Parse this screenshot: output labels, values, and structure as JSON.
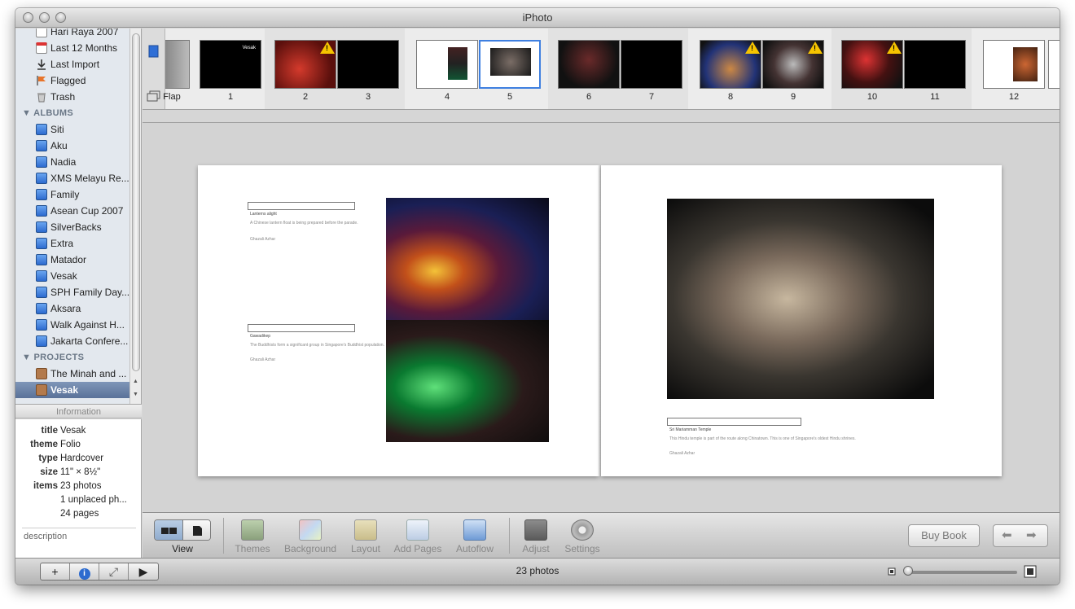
{
  "window": {
    "title": "iPhoto"
  },
  "sidebar": {
    "library_items": [
      {
        "label": "Hari Raya 2007",
        "icon": "event-icon"
      },
      {
        "label": "Last 12 Months",
        "icon": "calendar-icon"
      },
      {
        "label": "Last Import",
        "icon": "import-icon"
      },
      {
        "label": "Flagged",
        "icon": "flag-icon"
      },
      {
        "label": "Trash",
        "icon": "trash-icon"
      }
    ],
    "albums_header": "ALBUMS",
    "albums": [
      "Siti",
      "Aku",
      "Nadia",
      "XMS Melayu Re...",
      "Family",
      "Asean Cup 2007",
      "SilverBacks",
      "Extra",
      "Matador",
      "Vesak",
      "SPH Family Day...",
      "Aksara",
      "Walk Against H...",
      "Jakarta Confere..."
    ],
    "projects_header": "PROJECTS",
    "projects": [
      {
        "label": "The Minah and ...",
        "selected": false
      },
      {
        "label": "Vesak",
        "selected": true
      }
    ]
  },
  "info": {
    "header": "Information",
    "rows": [
      {
        "key": "title",
        "value": "Vesak"
      },
      {
        "key": "theme",
        "value": "Folio"
      },
      {
        "key": "type",
        "value": "Hardcover"
      },
      {
        "key": "size",
        "value": "11\" × 8½\""
      },
      {
        "key": "items",
        "value": "23 photos"
      },
      {
        "key": "",
        "value": "1 unplaced ph..."
      },
      {
        "key": "",
        "value": "24 pages"
      }
    ],
    "description_placeholder": "description"
  },
  "strip": {
    "pages": [
      {
        "label": "Flap",
        "style": "gray",
        "warning": false,
        "selected": false
      },
      {
        "label": "1",
        "style": "black",
        "warning": false,
        "selected": false,
        "text": "Vesak"
      },
      {
        "label": "2",
        "style": "photo-red",
        "warning": true,
        "selected": false
      },
      {
        "label": "3",
        "style": "black",
        "warning": false,
        "selected": false
      },
      {
        "label": "4",
        "style": "white",
        "warning": false,
        "selected": false
      },
      {
        "label": "5",
        "style": "white",
        "warning": false,
        "selected": true
      },
      {
        "label": "6",
        "style": "photo-night",
        "warning": false,
        "selected": false
      },
      {
        "label": "7",
        "style": "black",
        "warning": false,
        "selected": false
      },
      {
        "label": "8",
        "style": "photo-lights",
        "warning": true,
        "selected": false
      },
      {
        "label": "9",
        "style": "photo-night",
        "warning": true,
        "selected": false
      },
      {
        "label": "10",
        "style": "photo-lights",
        "warning": true,
        "selected": false
      },
      {
        "label": "11",
        "style": "black",
        "warning": false,
        "selected": false
      },
      {
        "label": "12",
        "style": "white",
        "warning": false,
        "selected": false
      }
    ]
  },
  "spread": {
    "left_captions": [
      {
        "title": "Lanterns alight",
        "body": "A Chinese lantern float is being prepared before the parade.",
        "credit": "Ghazali Azhar"
      },
      {
        "title": "Gawadikep",
        "body": "The Buddhists form a significant group in Singapore's Buddhist population.",
        "credit": "Ghazali Azhar"
      }
    ],
    "right_caption": {
      "title": "Sri Mariamman Temple",
      "body": "This Hindu temple is part of the route along Chinatown. This is one of Singapore's oldest Hindu shrines.",
      "credit": "Ghazali Azhar"
    }
  },
  "toolbar": {
    "view_label": "View",
    "buttons": [
      {
        "label": "Themes",
        "icon": "themes-icon"
      },
      {
        "label": "Background",
        "icon": "background-icon"
      },
      {
        "label": "Layout",
        "icon": "layout-icon"
      },
      {
        "label": "Add Pages",
        "icon": "add-pages-icon"
      },
      {
        "label": "Autoflow",
        "icon": "autoflow-icon"
      },
      {
        "label": "Adjust",
        "icon": "adjust-icon"
      },
      {
        "label": "Settings",
        "icon": "settings-icon"
      }
    ],
    "buy_book": "Buy Book"
  },
  "bottombar": {
    "status": "23 photos",
    "add": "+",
    "info": "i",
    "fullscreen": "⤢",
    "play": "▶",
    "zoom_level": 0.0
  },
  "colors": {
    "selection": "#5a7299",
    "sidebar_bg": "#e3e8ee",
    "canvas_bg": "#d3d3d3",
    "accent": "#3e7fe0"
  }
}
